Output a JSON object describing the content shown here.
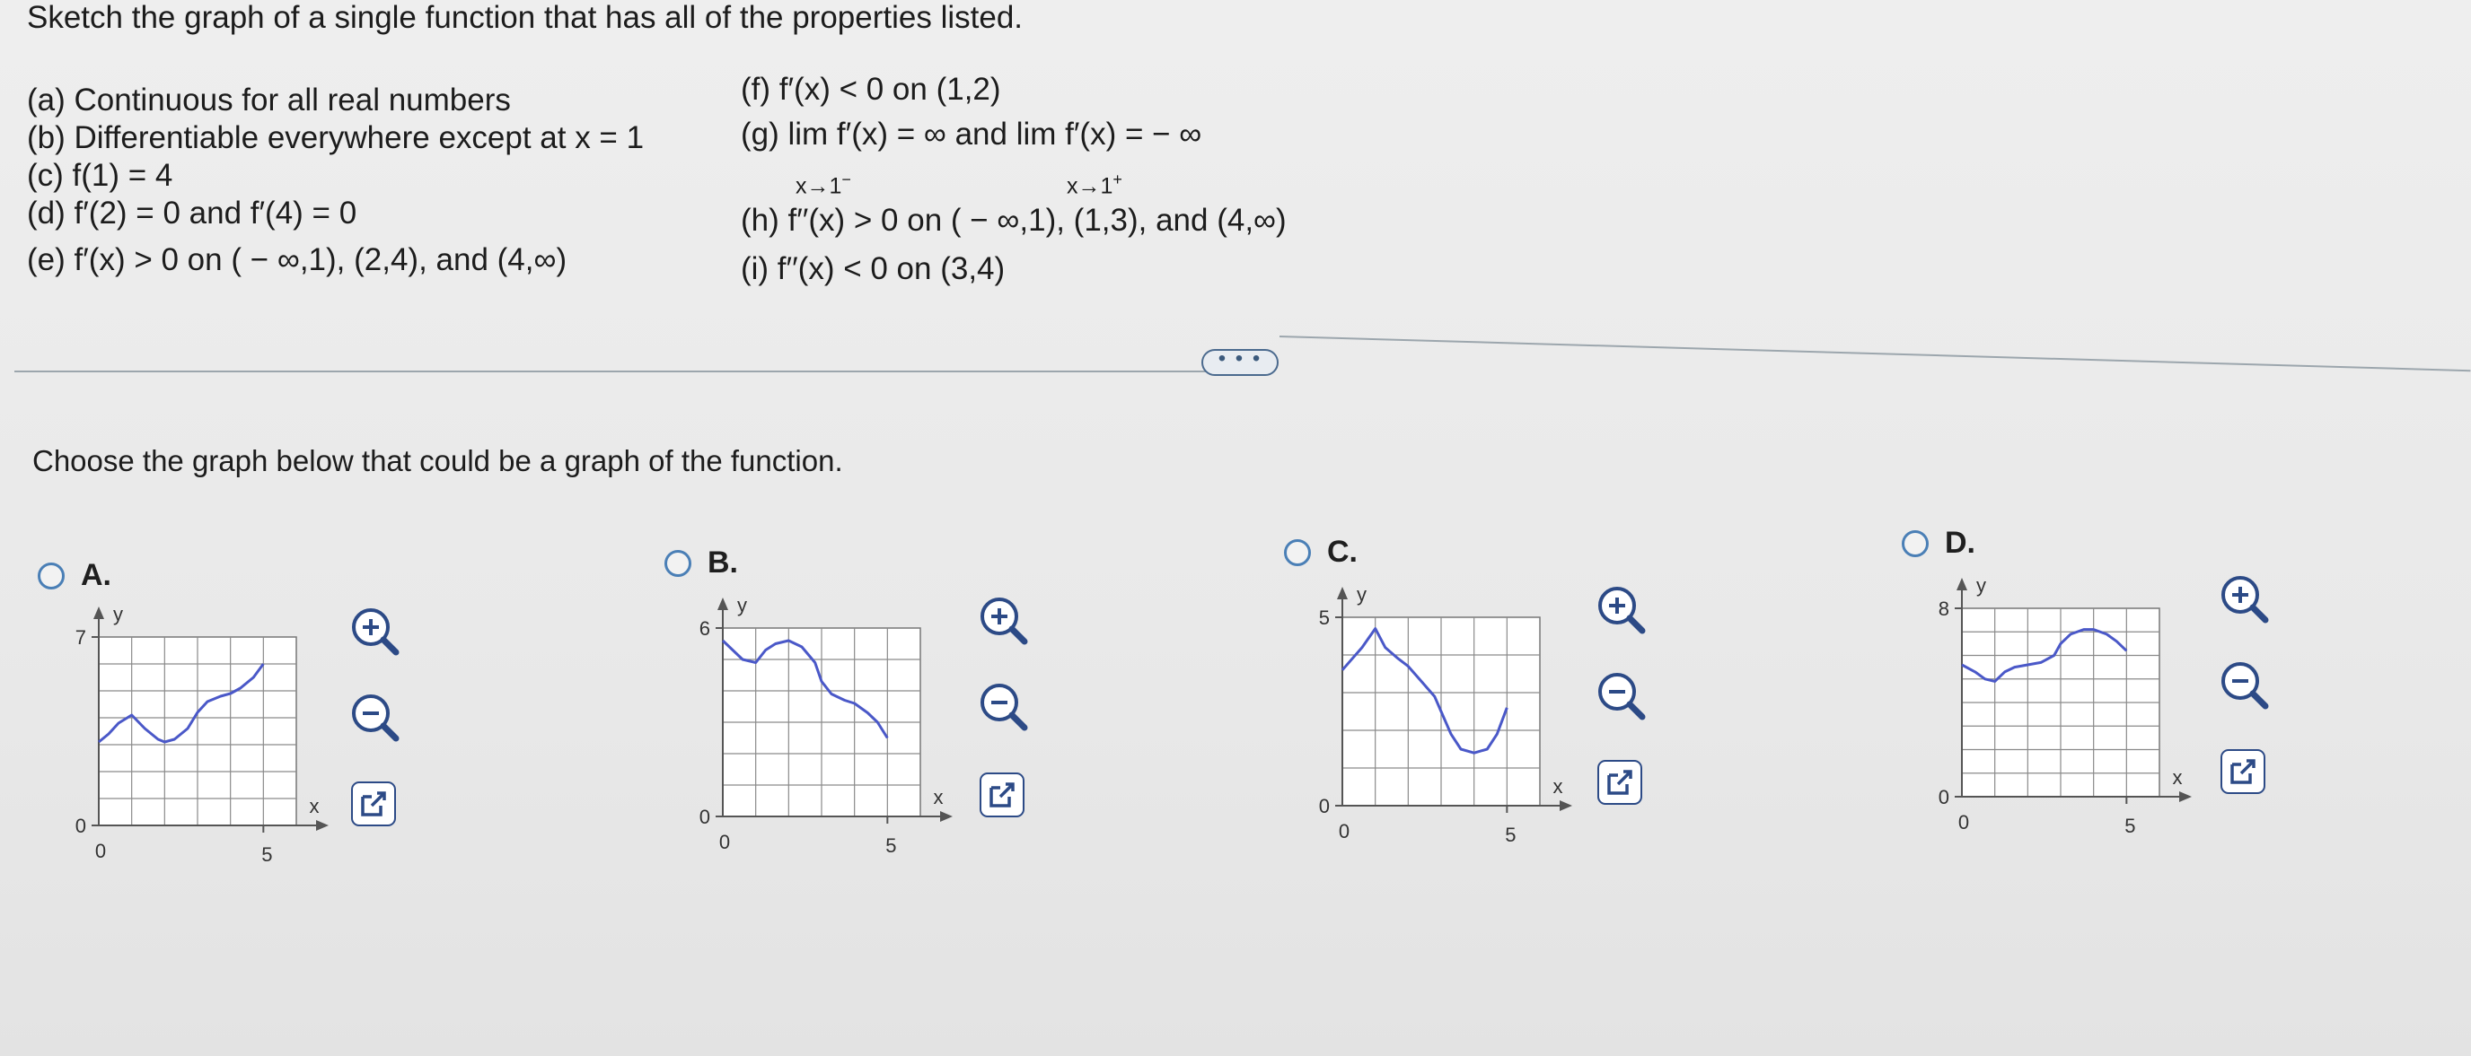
{
  "question": {
    "title": "Sketch the graph of a single function that has all of the properties listed.",
    "properties_left": [
      "(a) Continuous for all real numbers",
      "(b) Differentiable everywhere except at x = 1",
      "(c) f(1) = 4",
      "(d) f′(2) = 0 and f′(4) = 0",
      "(e) f′(x) > 0 on ( − ∞,1), (2,4), and (4,∞)"
    ],
    "properties_right": [
      "(f) f′(x) < 0 on (1,2)",
      "(g)  lim  f′(x) = ∞ and   lim  f′(x) = − ∞",
      "(h) f′′(x) > 0 on ( − ∞,1), (1,3), and (4,∞)",
      "(i) f′′(x) < 0 on (3,4)"
    ],
    "limit_subscripts": {
      "left": "x→1",
      "left_sup": "−",
      "right": "x→1",
      "right_sup": "+"
    }
  },
  "more_button": "• • •",
  "instruction": "Choose the graph below that could be a graph of the function.",
  "icons": {
    "zoom_in": "zoom-in-icon",
    "zoom_out": "zoom-out-icon",
    "open": "open-new-window-icon"
  },
  "colors": {
    "curve": "#4a58c8",
    "radio": "#4a7fb6",
    "icon": "#2c4a86"
  },
  "options": [
    {
      "letter": "A.",
      "y_label": "y",
      "x_label": "x",
      "y_tick": "7",
      "y_max": 7,
      "origin_label": "0",
      "x_origin": "0",
      "x_tick": "5",
      "curve": [
        [
          0,
          3.1
        ],
        [
          0.3,
          3.4
        ],
        [
          0.6,
          3.8
        ],
        [
          1,
          4.1
        ],
        [
          1.4,
          3.6
        ],
        [
          1.8,
          3.2
        ],
        [
          2,
          3.1
        ],
        [
          2.3,
          3.2
        ],
        [
          2.7,
          3.6
        ],
        [
          3,
          4.2
        ],
        [
          3.3,
          4.6
        ],
        [
          3.7,
          4.8
        ],
        [
          4,
          4.9
        ],
        [
          4.3,
          5.1
        ],
        [
          4.7,
          5.5
        ],
        [
          5,
          6
        ]
      ]
    },
    {
      "letter": "B.",
      "y_label": "y",
      "x_label": "x",
      "y_tick": "6",
      "y_max": 6,
      "origin_label": "0",
      "x_origin": "0",
      "x_tick": "5",
      "curve": [
        [
          0,
          5.6
        ],
        [
          0.3,
          5.3
        ],
        [
          0.6,
          5.0
        ],
        [
          1,
          4.9
        ],
        [
          1.3,
          5.3
        ],
        [
          1.6,
          5.5
        ],
        [
          2,
          5.6
        ],
        [
          2.4,
          5.4
        ],
        [
          2.8,
          4.9
        ],
        [
          3,
          4.3
        ],
        [
          3.3,
          3.9
        ],
        [
          3.7,
          3.7
        ],
        [
          4,
          3.6
        ],
        [
          4.4,
          3.3
        ],
        [
          4.7,
          3.0
        ],
        [
          5,
          2.5
        ]
      ]
    },
    {
      "letter": "C.",
      "y_label": "y",
      "x_label": "x",
      "y_tick": "5",
      "y_max": 5,
      "origin_label": "0",
      "x_origin": "0",
      "x_tick": "5",
      "curve": [
        [
          0,
          3.6
        ],
        [
          0.3,
          3.9
        ],
        [
          0.6,
          4.2
        ],
        [
          1,
          4.7
        ],
        [
          1.3,
          4.2
        ],
        [
          1.7,
          3.9
        ],
        [
          2,
          3.7
        ],
        [
          2.4,
          3.3
        ],
        [
          2.8,
          2.9
        ],
        [
          3,
          2.5
        ],
        [
          3.3,
          1.9
        ],
        [
          3.6,
          1.5
        ],
        [
          4,
          1.4
        ],
        [
          4.4,
          1.5
        ],
        [
          4.7,
          1.9
        ],
        [
          5,
          2.6
        ]
      ]
    },
    {
      "letter": "D.",
      "y_label": "y",
      "x_label": "x",
      "y_tick": "8",
      "y_max": 8,
      "origin_label": "0",
      "x_origin": "0",
      "x_tick": "5",
      "curve": [
        [
          0,
          5.6
        ],
        [
          0.4,
          5.3
        ],
        [
          0.7,
          5.0
        ],
        [
          1,
          4.9
        ],
        [
          1.3,
          5.3
        ],
        [
          1.6,
          5.5
        ],
        [
          2,
          5.6
        ],
        [
          2.4,
          5.7
        ],
        [
          2.8,
          6.0
        ],
        [
          3,
          6.5
        ],
        [
          3.3,
          6.9
        ],
        [
          3.7,
          7.1
        ],
        [
          4,
          7.1
        ],
        [
          4.4,
          6.9
        ],
        [
          4.7,
          6.6
        ],
        [
          5,
          6.2
        ]
      ]
    }
  ]
}
